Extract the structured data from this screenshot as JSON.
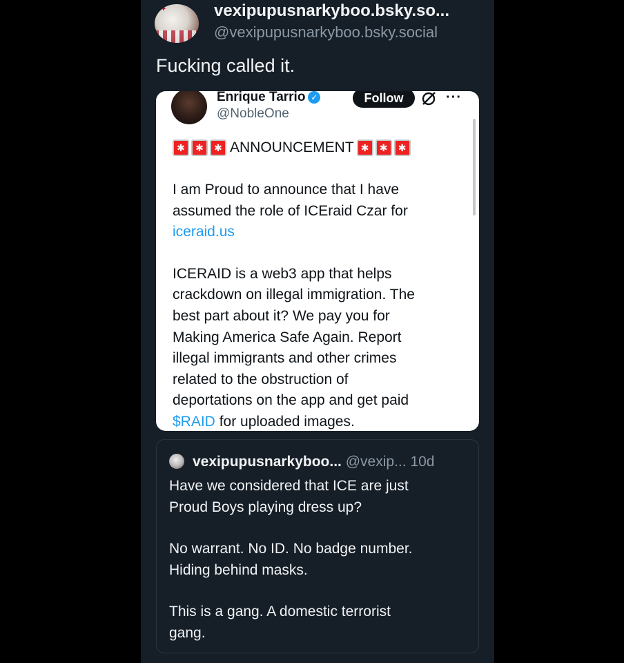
{
  "post": {
    "display_name": "vexipupusnarkyboo.bsky.so...",
    "handle": "@vexipupusnarkyboo.bsky.social",
    "text": "Fucking called it."
  },
  "embedded_tweet": {
    "author_name": "Enrique Tarrio",
    "author_handle": "@NobleOne",
    "follow_label": "Follow",
    "more_label": "···",
    "announcement_label": "ANNOUNCEMENT",
    "paragraph1_line1": "I am Proud to announce that I have",
    "paragraph1_line2": "assumed the role of ICEraid Czar for",
    "paragraph1_link": "iceraid.us",
    "paragraph2_text": "ICERAID is a web3 app that helps\ncrackdown on illegal immigration. The\nbest part about it? We pay you for\nMaking America Safe Again. Report\nillegal immigrants and other crimes\nrelated to the obstruction of\ndeportations on the app and get paid",
    "paragraph2_cashtag": "$RAID",
    "paragraph2_tail": " for uploaded images."
  },
  "quoted_reply": {
    "name": "vexipupusnarkyboo...",
    "handle": "@vexip...",
    "time": "10d",
    "paragraph1": "Have we considered that ICE are just\nProud Boys playing dress up?",
    "paragraph2": "No warrant. No ID. No badge number.\nHiding behind masks.",
    "paragraph3": "This is a gang. A domestic terrorist\ngang."
  },
  "colors": {
    "background": "#161e27",
    "link": "#1d9bf0",
    "muted": "#8b98a5",
    "verified": "#1d9bf0"
  }
}
